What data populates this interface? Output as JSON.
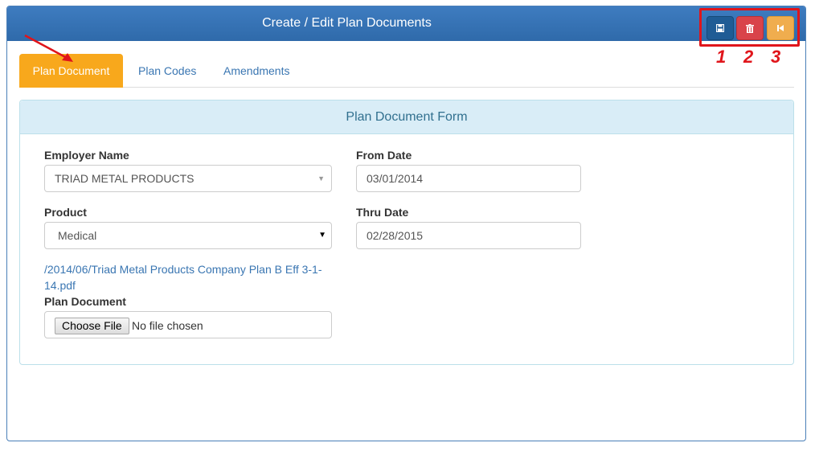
{
  "header": {
    "title": "Create / Edit Plan Documents",
    "buttons": [
      {
        "name": "save",
        "icon": "save-icon",
        "color": "#1f5c95"
      },
      {
        "name": "delete",
        "icon": "trash-icon",
        "color": "#d9434a"
      },
      {
        "name": "back",
        "icon": "skip-back-icon",
        "color": "#f0ad4e"
      }
    ],
    "annotations": [
      "1",
      "2",
      "3"
    ]
  },
  "tabs": [
    {
      "label": "Plan Document",
      "active": true
    },
    {
      "label": "Plan Codes",
      "active": false
    },
    {
      "label": "Amendments",
      "active": false
    }
  ],
  "form": {
    "title": "Plan Document Form",
    "employer_label": "Employer Name",
    "employer_value": "TRIAD METAL PRODUCTS",
    "from_date_label": "From Date",
    "from_date_value": "03/01/2014",
    "product_label": "Product",
    "product_value": "Medical",
    "thru_date_label": "Thru Date",
    "thru_date_value": "02/28/2015",
    "document_link": "/2014/06/Triad Metal Products Company Plan B Eff 3-1-14.pdf",
    "plan_document_label": "Plan Document",
    "file_button": "Choose File",
    "file_status": "No file chosen"
  },
  "colors": {
    "header": "#2f6aaa",
    "active_tab": "#f8a81c",
    "annotation": "#e0151b",
    "form_header_bg": "#d9edf7"
  }
}
